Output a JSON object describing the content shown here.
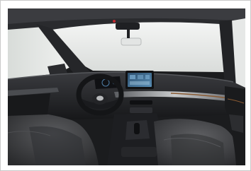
{
  "image": {
    "subject": "Car interior",
    "colors": {
      "windshield_light": "#eef0ef",
      "trim_dark": "#1c1d20",
      "seat_fabric": "#3a3b3e",
      "screen_blue": "#3e6f95",
      "ambient_accent": "#8a5a32"
    }
  }
}
